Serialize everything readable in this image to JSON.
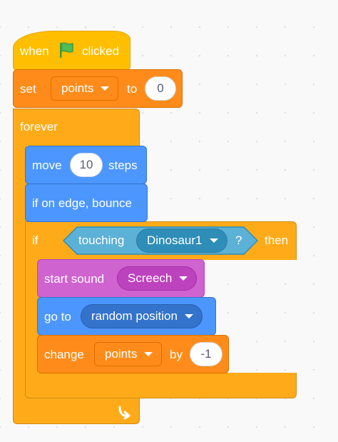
{
  "blocks": {
    "when_flag": {
      "prefix": "when",
      "suffix": "clicked",
      "flag_icon": "green-flag-icon",
      "color": "#ffbf00"
    },
    "set_var": {
      "label": "set",
      "variable": "points",
      "to_label": "to",
      "value": "0",
      "color": "#ff8c1a"
    },
    "forever": {
      "label": "forever",
      "loop_icon": "loop-arrow-icon",
      "color": "#ffab19"
    },
    "move": {
      "label": "move",
      "value": "10",
      "suffix": "steps",
      "color": "#4c97ff"
    },
    "bounce": {
      "label": "if on edge, bounce"
    },
    "if_block": {
      "if_label": "if",
      "then_label": "then",
      "condition": {
        "label": "touching",
        "target": "Dinosaur1",
        "suffix": "?",
        "color": "#5cb1d6"
      }
    },
    "start_sound": {
      "label": "start sound",
      "sound": "Screech",
      "color": "#cf63cf"
    },
    "go_to": {
      "label": "go to",
      "target": "random position"
    },
    "change_var": {
      "label": "change",
      "variable": "points",
      "by_label": "by",
      "value": "-1"
    }
  }
}
